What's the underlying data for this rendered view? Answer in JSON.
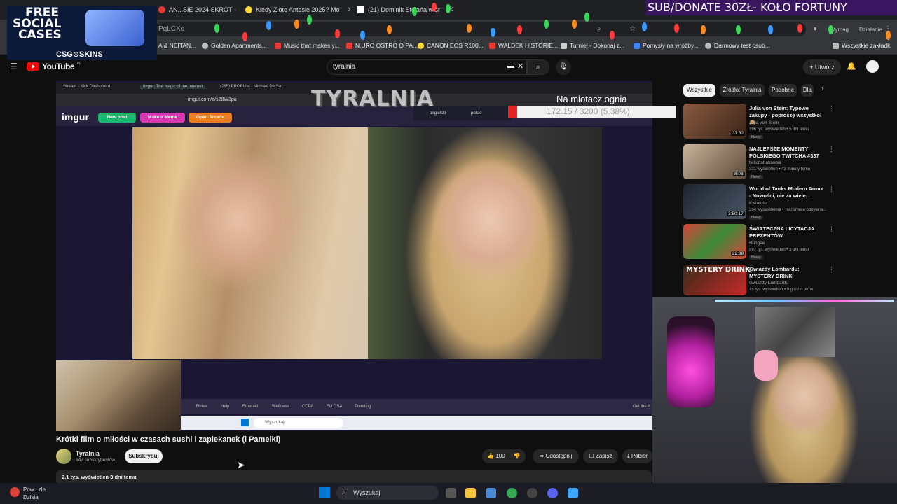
{
  "browser": {
    "tabs": [
      {
        "label": "AN...SIE 2024 SKRÓT -",
        "color": "#e53935"
      },
      {
        "label": "Kiedy Złote Antosie 2025? Mo",
        "color": "#fdd835"
      },
      {
        "label": "(21) Dominik Stelańa w sr",
        "color": "#ffffff"
      }
    ],
    "url_fragment": "PqLCXo",
    "profile_label": "Wymag",
    "action_label": "Działanie",
    "bookmarks": [
      {
        "label": "A & NEITAN...",
        "color": "#888888"
      },
      {
        "label": "Golden Apartments...",
        "color": "#bbbbbb"
      },
      {
        "label": "Music that makes y...",
        "color": "#e53935"
      },
      {
        "label": "N.URO OSTRO O PA...",
        "color": "#e53935"
      },
      {
        "label": "CANON EOS R100...",
        "color": "#fdd835"
      },
      {
        "label": "WALDEK HISTORIE...",
        "color": "#e53935"
      },
      {
        "label": "Turniej - Dokonaj z...",
        "color": "#cccccc"
      },
      {
        "label": "Pomysły na wróżby...",
        "color": "#4285f4"
      },
      {
        "label": "Darmowy test osob...",
        "color": "#bbbbbb"
      },
      {
        "label": "Wszystkie zakładki",
        "color": "#bbbbbb"
      }
    ]
  },
  "youtube": {
    "logo_text": "YouTube",
    "logo_region": "PL",
    "search_query": "tyralnia",
    "create_label": "Utwórz"
  },
  "player": {
    "inner_tabs": [
      "Stream - Kick Dashboard",
      "Imgur: The magic of the Internet",
      "(285) PROBLIM - Michael De Sa..."
    ],
    "inner_url": "imgur.com/a/s28W3pu",
    "imgur_logo": "imgur",
    "imgur_buttons": [
      {
        "label": "New post",
        "color": "#1bb76e"
      },
      {
        "label": "Make a Meme",
        "color": "#d63ab3"
      },
      {
        "label": "Open Arcade",
        "color": "#e67e22"
      }
    ],
    "overlay_title": "TYRALNIA",
    "languages": [
      "angielski",
      "polski"
    ],
    "progress_title": "Na miotacz ognia",
    "progress_text": "172.15 / 3200 (5.38%)",
    "progress_fraction": 0.0538,
    "progress_color": "#e02424",
    "footer_links": [
      "Rules",
      "Help",
      "Emerald",
      "Wellness",
      "CCPA",
      "EU DSA",
      "Trending"
    ],
    "footer_right": "Get the A",
    "inner_search": "Wyszukaj"
  },
  "video": {
    "title": "Krótki film o miłości w czasach sushi i zapiekanek (i Pamelki)",
    "channel": "Tyralnia",
    "subscribers": "647 subskrybentów",
    "subscribe_label": "Subskrybuj",
    "like_count": "100",
    "share_label": "Udostępnij",
    "save_label": "Zapisz",
    "download_label": "Pobier",
    "views": "2,1 tys. wyświetleń",
    "date": "3 dni temu"
  },
  "sidebar": {
    "chips": [
      "Wszystkie",
      "Źródło: Tyralnia",
      "Podobne",
      "Dla"
    ],
    "recommendations": [
      {
        "title": "Julia von Stein: Typowe zakupy - poproszę wszystko! 🙈",
        "channel": "Julia von Stein",
        "meta": "196 tys. wyświetleń • 5 dni temu",
        "badge": "Nowy",
        "duration": "37:32",
        "thumb": "#5a3a2e"
      },
      {
        "title": "NAJLEPSZE MOMENTY POLSKIEGO TWITCHA #337",
        "channel": "twitchshotownia",
        "meta": "331 wyświetleń • 43 minuty temu",
        "badge": "Nowy",
        "duration": "8:08",
        "thumb": "#7a6a58"
      },
      {
        "title": "World of Tanks Modern Armor - Nowości, nie za wiele...",
        "channel": "Kwiatosz",
        "meta": "534 wyświetlenia • Transmisja odbyła si...",
        "badge": "Nowy",
        "duration": "3:50:17",
        "thumb": "#2c3440"
      },
      {
        "title": "ŚWIĄTECZNA LICYTACJA PREZENTÓW",
        "channel": "Bungee",
        "meta": "997 tys. wyświetleń • 3 dni temu",
        "badge": "Nowy",
        "duration": "22:38",
        "thumb": "#b8302a"
      },
      {
        "title": "Gwiazdy Lombardu: MYSTERY DRINK",
        "channel": "Gwiazdy Lombardu",
        "meta": "15 tys. wyświetleń • 9 godzin temu",
        "badge": "",
        "duration": "",
        "thumb": "#3a2a18"
      }
    ],
    "rec4_thumb_text": "MYSTERY DRINK"
  },
  "overlays": {
    "donate_banner": "SUB/DONATE 30ZŁ- KOŁO FORTUNY",
    "promo_line1": "FREE",
    "promo_line2": "SOCIAL",
    "promo_line3": "CASES",
    "promo_brand": "CSG⊙SKINS"
  },
  "taskbar": {
    "weather_line1": "Pow.: złe",
    "weather_line2": "Dzisiaj",
    "search_label": "Wyszukaj"
  }
}
